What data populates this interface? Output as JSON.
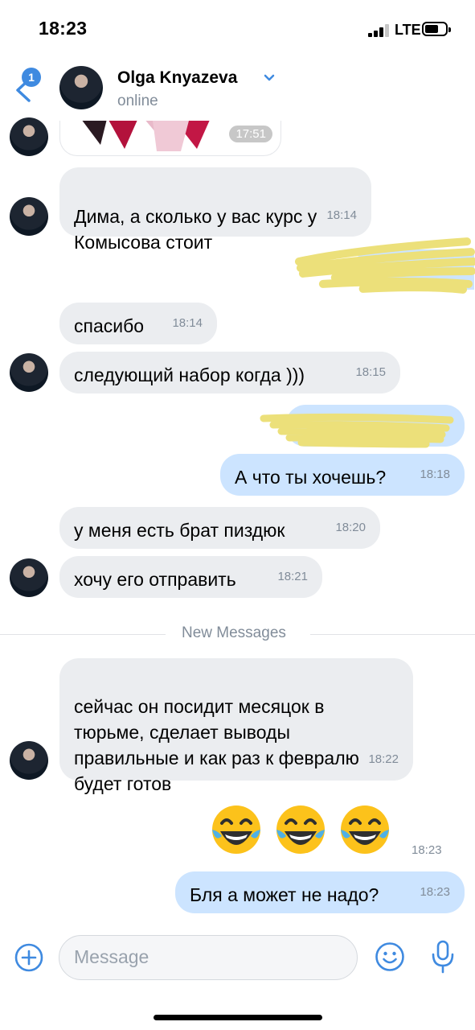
{
  "status_bar": {
    "time": "18:23",
    "network": "LTE"
  },
  "header": {
    "back_badge": "1",
    "contact_name": "Olga Knyazeva",
    "presence": "online"
  },
  "messages": [
    {
      "type": "sticker",
      "direction": "in",
      "time": "17:51"
    },
    {
      "type": "text",
      "direction": "in",
      "text": "Дима, а сколько у вас курс у\nКомысова стоит",
      "time": "18:14"
    },
    {
      "type": "redacted",
      "direction": "out"
    },
    {
      "type": "text",
      "direction": "in",
      "text": "спасибо",
      "time": "18:14"
    },
    {
      "type": "text",
      "direction": "in",
      "text": "следующий набор когда )))",
      "time": "18:15"
    },
    {
      "type": "redacted",
      "direction": "out"
    },
    {
      "type": "text",
      "direction": "out",
      "text": "А что ты хочешь?",
      "time": "18:18"
    },
    {
      "type": "text",
      "direction": "in",
      "text": "у меня есть брат пиздюк",
      "time": "18:20"
    },
    {
      "type": "text",
      "direction": "in",
      "text": "хочу его отправить",
      "time": "18:21"
    },
    {
      "type": "text",
      "direction": "in",
      "text": "сейчас он посидит месяцок в\nтюрьме, сделает выводы\nправильные и как раз к февралю\nбудет готов",
      "time": "18:22"
    },
    {
      "type": "emoji",
      "direction": "out",
      "text": "😂😂😂",
      "time": "18:23"
    },
    {
      "type": "text",
      "direction": "out",
      "text": "Бля а может не надо?",
      "time": "18:23"
    }
  ],
  "divider_label": "New Messages",
  "composer": {
    "placeholder": "Message"
  },
  "colors": {
    "accent": "#3f8ae0",
    "incoming_bubble": "#ebedf0",
    "outgoing_bubble": "#cce4ff",
    "redaction": "#ece07a"
  }
}
